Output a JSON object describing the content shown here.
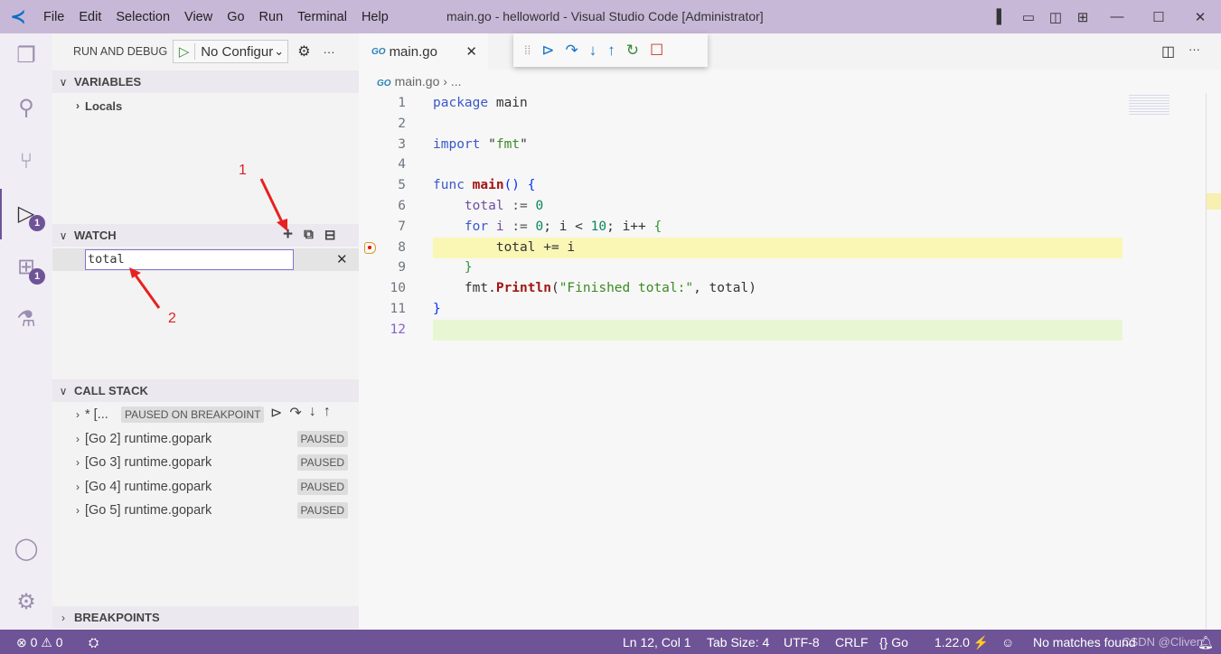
{
  "window": {
    "title": "main.go - helloworld - Visual Studio Code [Administrator]",
    "menu": [
      "File",
      "Edit",
      "Selection",
      "View",
      "Go",
      "Run",
      "Terminal",
      "Help"
    ]
  },
  "activity": {
    "run_badge": "1",
    "extensions_badge": "1"
  },
  "sidebar": {
    "title": "RUN AND DEBUG",
    "config": "No Configurations",
    "variables": {
      "title": "VARIABLES",
      "items": [
        "Locals"
      ]
    },
    "watch": {
      "title": "WATCH",
      "input_value": "total"
    },
    "call_stack": {
      "title": "CALL STACK",
      "threads": [
        {
          "name": "* [...",
          "status": "PAUSED ON BREAKPOINT"
        },
        {
          "name": "[Go 2] runtime.gopark",
          "status": "PAUSED"
        },
        {
          "name": "[Go 3] runtime.gopark",
          "status": "PAUSED"
        },
        {
          "name": "[Go 4] runtime.gopark",
          "status": "PAUSED"
        },
        {
          "name": "[Go 5] runtime.gopark",
          "status": "PAUSED"
        }
      ]
    },
    "breakpoints": {
      "title": "BREAKPOINTS"
    }
  },
  "editor": {
    "tab": "main.go",
    "breadcrumb": "main.go",
    "breadcrumb_more": "...",
    "current_line": 8,
    "lines": [
      [
        [
          "package",
          "kw"
        ],
        [
          " main",
          ""
        ]
      ],
      [],
      [
        [
          "import",
          "kw"
        ],
        [
          " \"",
          ""
        ],
        [
          "fmt",
          "str"
        ],
        [
          "\"",
          ""
        ]
      ],
      [],
      [
        [
          "func",
          "kw"
        ],
        [
          " ",
          ""
        ],
        [
          "main",
          "fn"
        ],
        [
          "()",
          "br"
        ],
        [
          " ",
          ""
        ],
        [
          "{",
          "br"
        ]
      ],
      [
        [
          "    ",
          ""
        ],
        [
          "total",
          "var"
        ],
        [
          " := ",
          "op"
        ],
        [
          "0",
          "num_"
        ]
      ],
      [
        [
          "    ",
          ""
        ],
        [
          "for",
          "kw"
        ],
        [
          " ",
          ""
        ],
        [
          "i",
          "var"
        ],
        [
          " := ",
          "op"
        ],
        [
          "0",
          "num_"
        ],
        [
          "; i < ",
          ""
        ],
        [
          "10",
          "num_"
        ],
        [
          "; i++ ",
          ""
        ],
        [
          "{",
          "br2"
        ]
      ],
      [
        [
          "        total += i",
          ""
        ]
      ],
      [
        [
          "    ",
          ""
        ],
        [
          "}",
          "br2"
        ]
      ],
      [
        [
          "    fmt.",
          ""
        ],
        [
          "Println",
          "fn"
        ],
        [
          "(",
          ""
        ],
        [
          "\"Finished total:\"",
          "str"
        ],
        [
          ", total)",
          ""
        ]
      ],
      [
        [
          "}",
          "br"
        ]
      ],
      []
    ]
  },
  "annotations": [
    "1",
    "2"
  ],
  "status": {
    "errors": "0",
    "warnings": "0",
    "position": "Ln 12, Col 1",
    "tab_size": "Tab Size: 4",
    "encoding": "UTF-8",
    "eol": "CRLF",
    "language": "Go",
    "go_version": "1.22.0",
    "search": "No matches found",
    "watermark": "CSDN @Cliven"
  },
  "colors": {
    "accent": "#6f5397",
    "titlebar": "#c8b8d8",
    "current_line": "#faf7b5"
  }
}
